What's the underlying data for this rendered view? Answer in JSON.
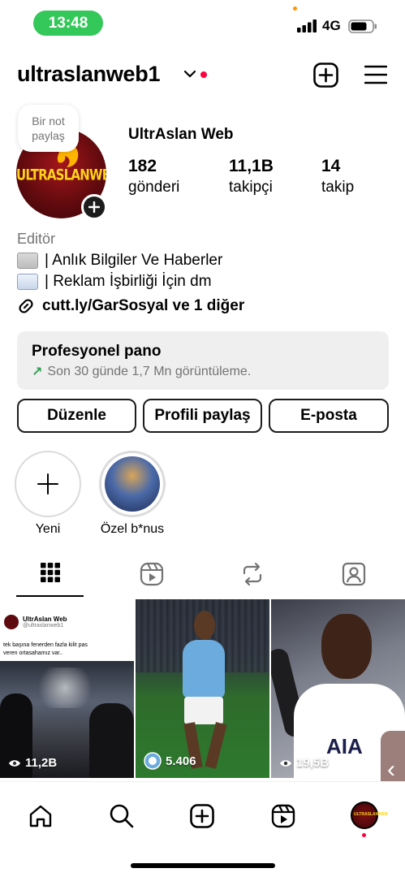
{
  "status_bar": {
    "time": "13:48",
    "network": "4G"
  },
  "header": {
    "username": "ultraslanweb1"
  },
  "profile": {
    "note": [
      "Bir not",
      "paylaş"
    ],
    "avatar_logo_text": "ULTRASLANWEB",
    "display_name": "UltrAslan Web",
    "stats": [
      {
        "value": "182",
        "label": "gönderi"
      },
      {
        "value": "11,1B",
        "label": "takipçi"
      },
      {
        "value": "14",
        "label": "takip"
      }
    ],
    "category": "Editör",
    "bio": [
      "| Anlık Bilgiler Ve Haberler",
      "| Reklam İşbirliği İçin dm"
    ],
    "link": "cutt.ly/GarSosyal ve 1 diğer"
  },
  "dashboard": {
    "title": "Profesyonel pano",
    "arrow": "↗",
    "subtitle": "Son 30 günde 1,7 Mn görüntüleme."
  },
  "buttons": {
    "edit": "Düzenle",
    "share": "Profili paylaş",
    "email": "E-posta"
  },
  "highlights": [
    {
      "label": "Yeni"
    },
    {
      "label": "Özel b*nus"
    }
  ],
  "posts": [
    {
      "views": "11,2B",
      "author": "UltrAslan Web",
      "handle": "@ultraslanweb1",
      "caption": "tek başına fenerden fazla kilit pas veren ortasahamız var.."
    },
    {
      "views": "5.406"
    },
    {
      "views": "19,5B",
      "shirt_text": "AIA"
    }
  ],
  "colors": {
    "status_green": "#34c759",
    "notification_red": "#ff0040",
    "accent_green": "#2e9e4f"
  }
}
